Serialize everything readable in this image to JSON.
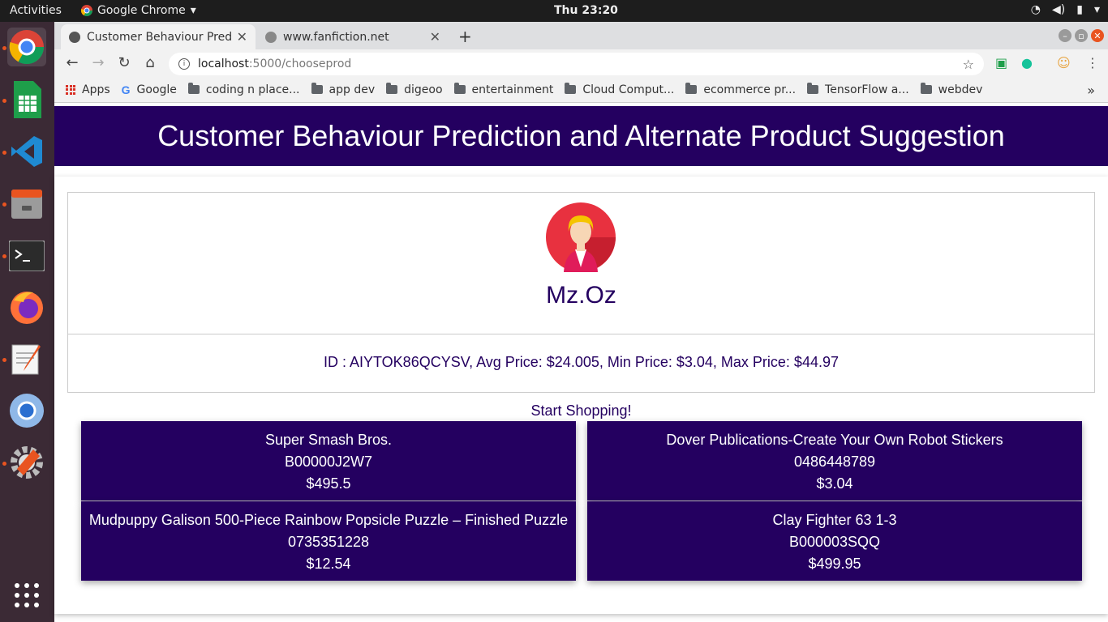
{
  "topbar": {
    "activities": "Activities",
    "app_name": "Google Chrome",
    "clock": "Thu 23:20"
  },
  "dock": {
    "items": [
      "chrome-icon",
      "spreadsheet-icon",
      "vscode-icon",
      "files-icon",
      "terminal-icon",
      "firefox-icon",
      "text-editor-icon",
      "chromium-icon",
      "settings-icon",
      "app-grid-icon"
    ]
  },
  "browser": {
    "tabs": [
      {
        "title": "Customer Behaviour Prediction",
        "active": true
      },
      {
        "title": "www.fanfiction.net",
        "active": false
      }
    ],
    "url_host": "localhost",
    "url_path": ":5000/chooseprod",
    "bookmarks": [
      "Apps",
      "Google",
      "coding n place...",
      "app dev",
      "digeoo",
      "entertainment",
      "Cloud Comput...",
      "ecommerce pr...",
      "TensorFlow a...",
      "webdev"
    ]
  },
  "page": {
    "header_title": "Customer Behaviour Prediction and Alternate Product Suggestion",
    "username": "Mz.Oz",
    "info": "ID : AIYTOK86QCYSV, Avg Price: $24.005, Min Price: $3.04, Max Price: $44.97",
    "start_label": "Start Shopping!",
    "products": [
      {
        "name": "Super Smash Bros.",
        "id": "B00000J2W7",
        "price": "$495.5"
      },
      {
        "name": "Dover Publications-Create Your Own Robot Stickers",
        "id": "0486448789",
        "price": "$3.04"
      },
      {
        "name": "Mudpuppy Galison 500-Piece Rainbow Popsicle Puzzle – Finished Puzzle",
        "id": "0735351228",
        "price": "$12.54"
      },
      {
        "name": "Clay Fighter 63 1-3",
        "id": "B000003SQQ",
        "price": "$499.95"
      }
    ]
  },
  "colors": {
    "brand": "#240060",
    "accent_orange": "#e95420"
  }
}
